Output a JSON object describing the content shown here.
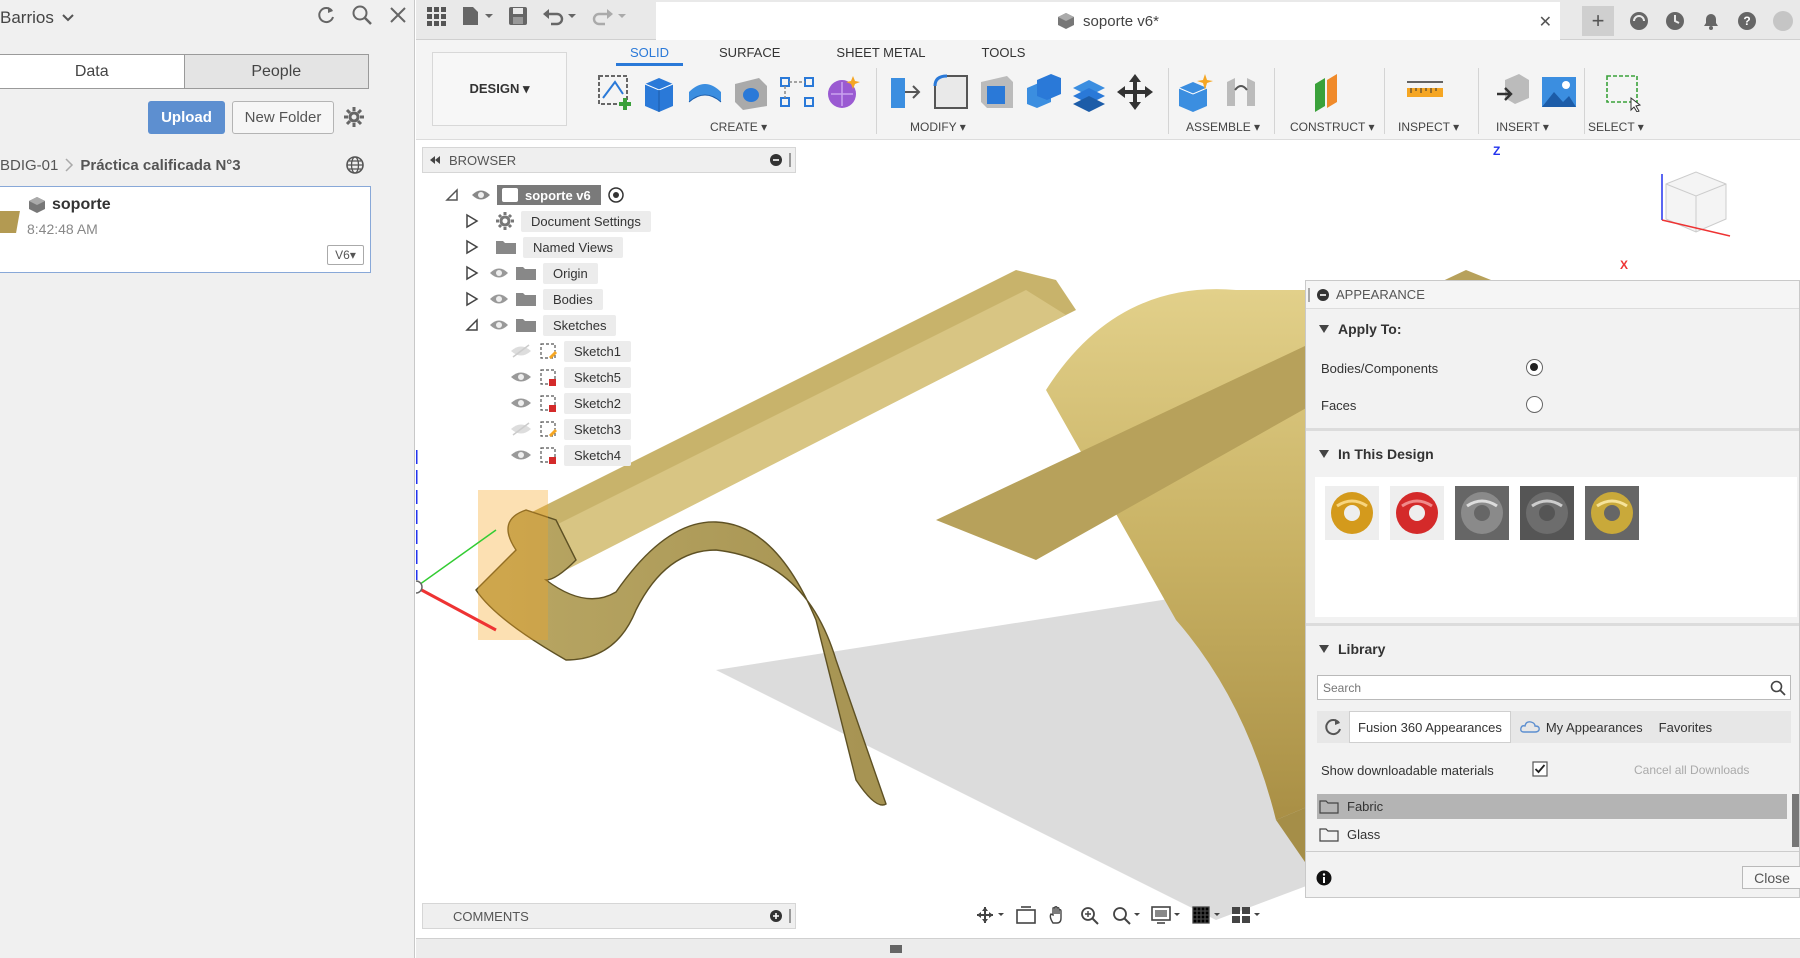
{
  "data_panel": {
    "title": "Barrios",
    "tabs": [
      "Data",
      "People"
    ],
    "upload_label": "Upload",
    "new_folder_label": "New Folder",
    "breadcrumb": {
      "parent": "BDIG-01",
      "current": "Práctica calificada N°3"
    },
    "file": {
      "name": "soporte",
      "time": "8:42:48 AM",
      "version": "V6▾"
    }
  },
  "document": {
    "tab_title": "soporte v6*"
  },
  "toolbar": {
    "workspace": "DESIGN ▾",
    "tabs": [
      "SOLID",
      "SURFACE",
      "SHEET METAL",
      "TOOLS"
    ],
    "groups": {
      "create": "CREATE ▾",
      "modify": "MODIFY ▾",
      "assemble": "ASSEMBLE ▾",
      "construct": "CONSTRUCT ▾",
      "inspect": "INSPECT ▾",
      "insert": "INSERT ▾",
      "select": "SELECT ▾"
    }
  },
  "browser": {
    "title": "BROWSER",
    "root": "soporte v6",
    "items": [
      "Document Settings",
      "Named Views",
      "Origin",
      "Bodies",
      "Sketches"
    ],
    "sketches": [
      "Sketch1",
      "Sketch5",
      "Sketch2",
      "Sketch3",
      "Sketch4"
    ]
  },
  "comments": {
    "title": "COMMENTS"
  },
  "appearance": {
    "title": "APPEARANCE",
    "apply_to_title": "Apply To:",
    "option_bodies": "Bodies/Components",
    "option_faces": "Faces",
    "in_design_title": "In This Design",
    "library_title": "Library",
    "search_placeholder": "Search",
    "lib_tabs": [
      "Fusion 360 Appearances",
      "My Appearances",
      "Favorites"
    ],
    "show_downloadable": "Show downloadable materials",
    "cancel_downloads": "Cancel all Downloads",
    "categories": [
      "Fabric",
      "Glass"
    ],
    "close_label": "Close",
    "swatch_colors": [
      "#d49a1c",
      "#d42a2a",
      "#8a8a8a",
      "#6d6d6d",
      "#c9a93a"
    ]
  },
  "colors": {
    "accent": "#2a79d8",
    "upload": "#5d8fd0",
    "model": "#c7b15d"
  }
}
